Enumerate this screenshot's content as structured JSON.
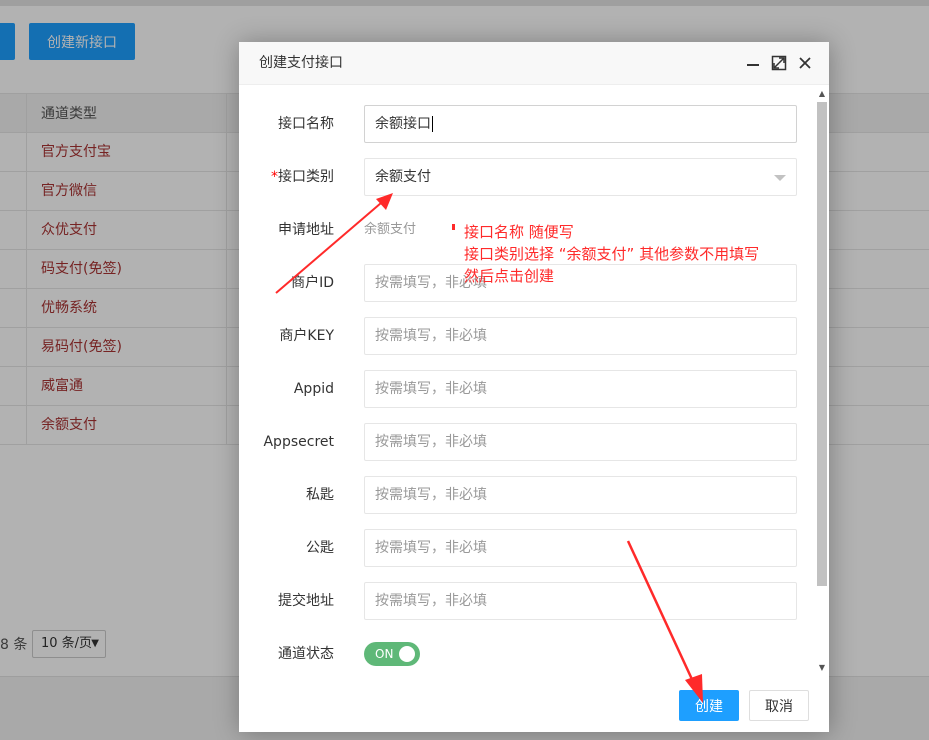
{
  "background": {
    "create_new_button": "创建新接口",
    "table": {
      "column_header": "通道类型",
      "rows": [
        "官方支付宝",
        "官方微信",
        "众优支付",
        "码支付(免签)",
        "优畅系统",
        "易码付(免签)",
        "威富通",
        "余额支付"
      ]
    },
    "pager": {
      "count_text": "8 条",
      "page_size": "10 条/页"
    }
  },
  "dialog": {
    "title": "创建支付接口",
    "fields": {
      "name": {
        "label": "接口名称",
        "value": "余额接口"
      },
      "category": {
        "required_mark": "*",
        "label": "接口类别",
        "value": "余额支付"
      },
      "apply_address": {
        "label": "申请地址",
        "value": "余额支付"
      },
      "merchant_id": {
        "label": "商户ID",
        "placeholder": "按需填写，非必填"
      },
      "merchant_key": {
        "label": "商户KEY",
        "placeholder": "按需填写，非必填"
      },
      "appid": {
        "label": "Appid",
        "placeholder": "按需填写，非必填"
      },
      "appsecret": {
        "label": "Appsecret",
        "placeholder": "按需填写，非必填"
      },
      "private_key": {
        "label": "私匙",
        "placeholder": "按需填写，非必填"
      },
      "public_key": {
        "label": "公匙",
        "placeholder": "按需填写，非必填"
      },
      "submit_address": {
        "label": "提交地址",
        "placeholder": "按需填写，非必填"
      },
      "channel_status": {
        "label": "通道状态",
        "switch_text": "ON"
      }
    },
    "buttons": {
      "submit": "创建",
      "cancel": "取消"
    }
  },
  "annotation": {
    "color": "#ff2a2a",
    "lines": [
      "接口名称 随便写",
      "接口类别选择 “余额支付” 其他参数不用填写",
      "然后点击创建"
    ]
  },
  "colors": {
    "primary": "#1e9fff",
    "switch_on": "#5fb878",
    "annotation": "#ff2a2a"
  },
  "icons": [
    "minimize-icon",
    "maximize-icon",
    "close-icon",
    "dropdown-arrow-icon"
  ]
}
